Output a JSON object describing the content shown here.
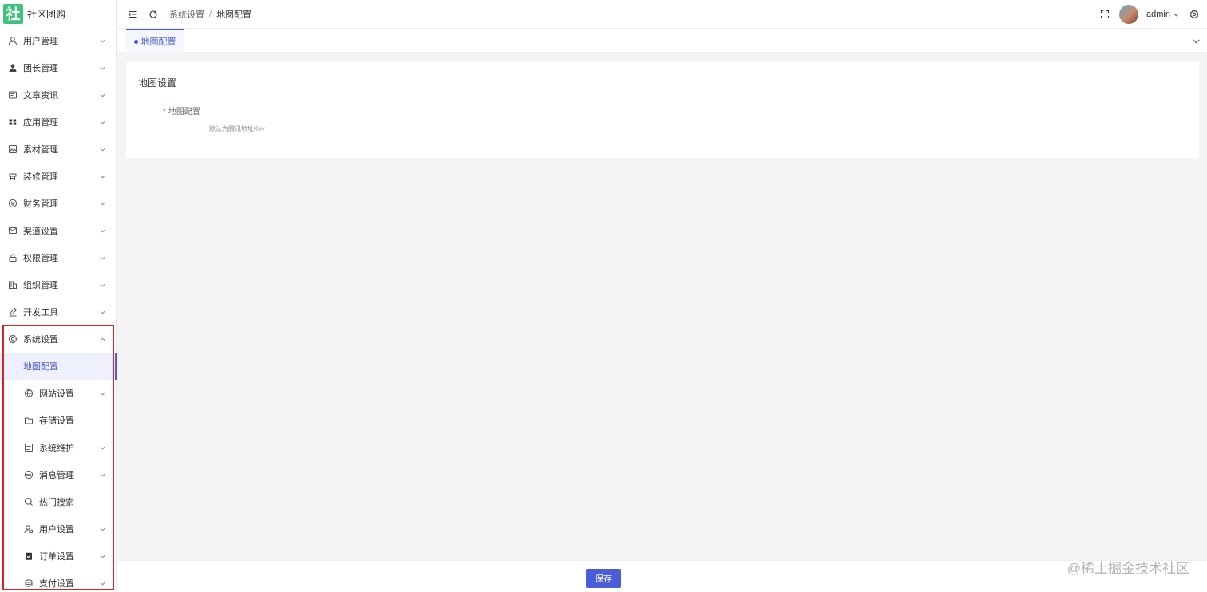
{
  "app": {
    "logo_char": "社",
    "title": "社区团购"
  },
  "sidebar": {
    "items": [
      {
        "label": "用户管理",
        "icon": "user-icon"
      },
      {
        "label": "团长管理",
        "icon": "person-icon"
      },
      {
        "label": "文章资讯",
        "icon": "article-icon"
      },
      {
        "label": "应用管理",
        "icon": "apps-icon"
      },
      {
        "label": "素材管理",
        "icon": "image-icon"
      },
      {
        "label": "装修管理",
        "icon": "decor-icon"
      },
      {
        "label": "财务管理",
        "icon": "finance-icon"
      },
      {
        "label": "渠道设置",
        "icon": "mail-icon"
      },
      {
        "label": "权限管理",
        "icon": "lock-icon"
      },
      {
        "label": "组织管理",
        "icon": "building-icon"
      },
      {
        "label": "开发工具",
        "icon": "pen-icon"
      },
      {
        "label": "系统设置",
        "icon": "gear-icon"
      }
    ],
    "sub_items": [
      {
        "label": "地图配置",
        "icon": ""
      },
      {
        "label": "网站设置",
        "icon": "globe-icon"
      },
      {
        "label": "存储设置",
        "icon": "folder-icon"
      },
      {
        "label": "系统维护",
        "icon": "monitor-icon"
      },
      {
        "label": "消息管理",
        "icon": "chat-icon"
      },
      {
        "label": "热门搜索",
        "icon": "search-icon"
      },
      {
        "label": "用户设置",
        "icon": "user-settings-icon"
      },
      {
        "label": "订单设置",
        "icon": "order-icon"
      },
      {
        "label": "支付设置",
        "icon": "pay-icon"
      }
    ]
  },
  "header": {
    "breadcrumb": [
      "系统设置",
      "地图配置"
    ],
    "user": "admin"
  },
  "tabs": [
    {
      "label": "地图配置"
    }
  ],
  "main": {
    "card_title": "地图设置",
    "field_label": "地图配置",
    "field_help": "默认为腾讯地址Key"
  },
  "footer": {
    "save_label": "保存"
  },
  "watermark": "@稀土掘金技术社区",
  "colors": {
    "accent": "#4b5cd9",
    "logo": "#3cc47c",
    "highlight": "#e02020"
  }
}
